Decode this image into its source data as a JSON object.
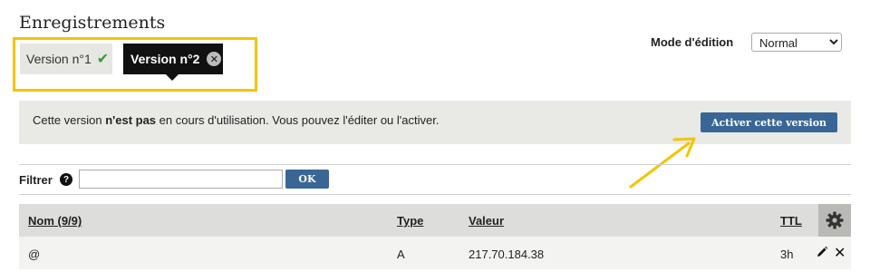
{
  "header": {
    "title": "Enregistrements"
  },
  "versions": [
    {
      "label": "Version n°1",
      "status_icon": "check-icon",
      "active": false
    },
    {
      "label": "Version n°2",
      "status_icon": "close-icon",
      "selected": true
    }
  ],
  "edit_mode": {
    "label": "Mode d'édition",
    "value": "Normal"
  },
  "info": {
    "text_before": "Cette version ",
    "text_bold": "n'est pas",
    "text_after": " en cours d'utilisation. Vous pouvez l'éditer ou l'activer.",
    "activate_label": "Activer cette version"
  },
  "filter": {
    "label": "Filtrer",
    "help_symbol": "?",
    "value": "",
    "ok_label": "OK"
  },
  "table": {
    "columns": {
      "nom": "Nom (9/9)",
      "type": "Type",
      "valeur": "Valeur",
      "ttl": "TTL"
    },
    "rows": [
      {
        "nom": "@",
        "type": "A",
        "valeur": "217.70.184.38",
        "ttl": "3h"
      }
    ]
  },
  "colors": {
    "accent_button": "#3a6696",
    "highlight": "#f5c400",
    "selected_tab": "#111111",
    "check": "#3a9a3a"
  }
}
